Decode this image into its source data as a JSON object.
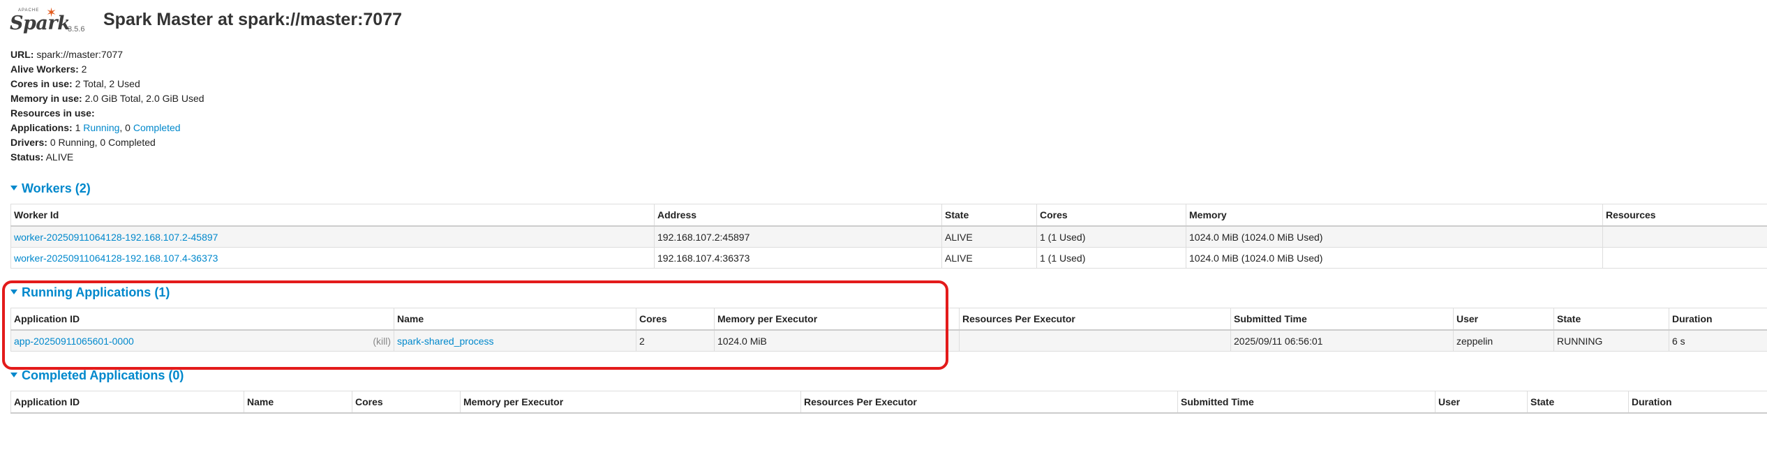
{
  "header": {
    "logo_apache": "APACHE",
    "logo_text": "Spark",
    "version": "3.5.6",
    "title": "Spark Master at spark://master:7077"
  },
  "info": {
    "url_label": "URL:",
    "url_value": "spark://master:7077",
    "workers_label": "Alive Workers:",
    "workers_value": "2",
    "cores_label": "Cores in use:",
    "cores_value": "2 Total, 2 Used",
    "memory_label": "Memory in use:",
    "memory_value": "2.0 GiB Total, 2.0 GiB Used",
    "resources_label": "Resources in use:",
    "apps_label": "Applications:",
    "apps_running_count": "1",
    "apps_running_link": "Running",
    "apps_sep": ", 0",
    "apps_completed_link": "Completed",
    "drivers_label": "Drivers:",
    "drivers_value": "0 Running, 0 Completed",
    "status_label": "Status:",
    "status_value": "ALIVE"
  },
  "workers": {
    "heading": "Workers (2)",
    "columns": [
      "Worker Id",
      "Address",
      "State",
      "Cores",
      "Memory",
      "Resources"
    ],
    "rows": [
      {
        "id": "worker-20250911064128-192.168.107.2-45897",
        "address": "192.168.107.2:45897",
        "state": "ALIVE",
        "cores": "1 (1 Used)",
        "memory": "1024.0 MiB (1024.0 MiB Used)",
        "resources": ""
      },
      {
        "id": "worker-20250911064128-192.168.107.4-36373",
        "address": "192.168.107.4:36373",
        "state": "ALIVE",
        "cores": "1 (1 Used)",
        "memory": "1024.0 MiB (1024.0 MiB Used)",
        "resources": ""
      }
    ]
  },
  "running": {
    "heading": "Running Applications (1)",
    "columns": [
      "Application ID",
      "Name",
      "Cores",
      "Memory per Executor",
      "Resources Per Executor",
      "Submitted Time",
      "User",
      "State",
      "Duration"
    ],
    "rows": [
      {
        "app_id": "app-20250911065601-0000",
        "kill": "(kill)",
        "name": "spark-shared_process",
        "cores": "2",
        "memory": "1024.0 MiB",
        "resources": "",
        "submitted": "2025/09/11 06:56:01",
        "user": "zeppelin",
        "state": "RUNNING",
        "duration": "6 s"
      }
    ]
  },
  "completed": {
    "heading": "Completed Applications (0)",
    "columns": [
      "Application ID",
      "Name",
      "Cores",
      "Memory per Executor",
      "Resources Per Executor",
      "Submitted Time",
      "User",
      "State",
      "Duration"
    ]
  },
  "colors": {
    "link": "#0088cc",
    "highlight": "#e31b1b",
    "logo_star": "#e25a1c"
  }
}
